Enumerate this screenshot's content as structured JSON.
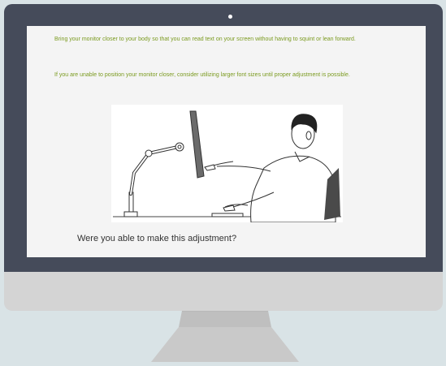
{
  "screen": {
    "instruction_1": "Bring your monitor closer to your body so that you can read text on your screen without having to squint or lean forward.",
    "instruction_2": "If you are unable to position your monitor closer, consider utilizing larger font sizes until proper adjustment is possible.",
    "question": "Were you able to make this adjustment?"
  },
  "colors": {
    "background": "#d9e3e6",
    "bezel": "#454b5a",
    "screen": "#f4f4f4",
    "instruction_text": "#7a9a1e",
    "question_text": "#333333",
    "chin": "#d4d4d4",
    "stand": "#c8c8c8"
  },
  "icons": {
    "illustration": "person-at-monitor-arm-illustration"
  }
}
